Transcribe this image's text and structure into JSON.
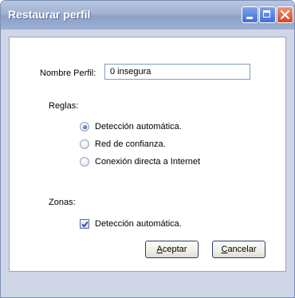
{
  "window": {
    "title": "Restaurar perfil",
    "controls": [
      "minimize-icon",
      "maximize-icon",
      "close-icon"
    ]
  },
  "profile": {
    "name_label": "Nombre Perfil:",
    "name_value": "0 insegura"
  },
  "rules": {
    "label": "Reglas:",
    "options": [
      {
        "label": "Detección automática.",
        "selected": true
      },
      {
        "label": "Red de confianza.",
        "selected": false
      },
      {
        "label": "Conexión directa a Internet",
        "selected": false
      }
    ]
  },
  "zones": {
    "label": "Zonas:",
    "auto_detect": {
      "label": "Detección automática.",
      "checked": true
    }
  },
  "buttons": {
    "accept": {
      "accel": "A",
      "rest": "ceptar"
    },
    "cancel": {
      "accel": "C",
      "rest": "ancelar"
    }
  },
  "colors": {
    "titlebar": "#9fb1d3",
    "frame": "#cfd6e6",
    "close_button": "#d44520",
    "radio_dot": "#3b62b8"
  }
}
